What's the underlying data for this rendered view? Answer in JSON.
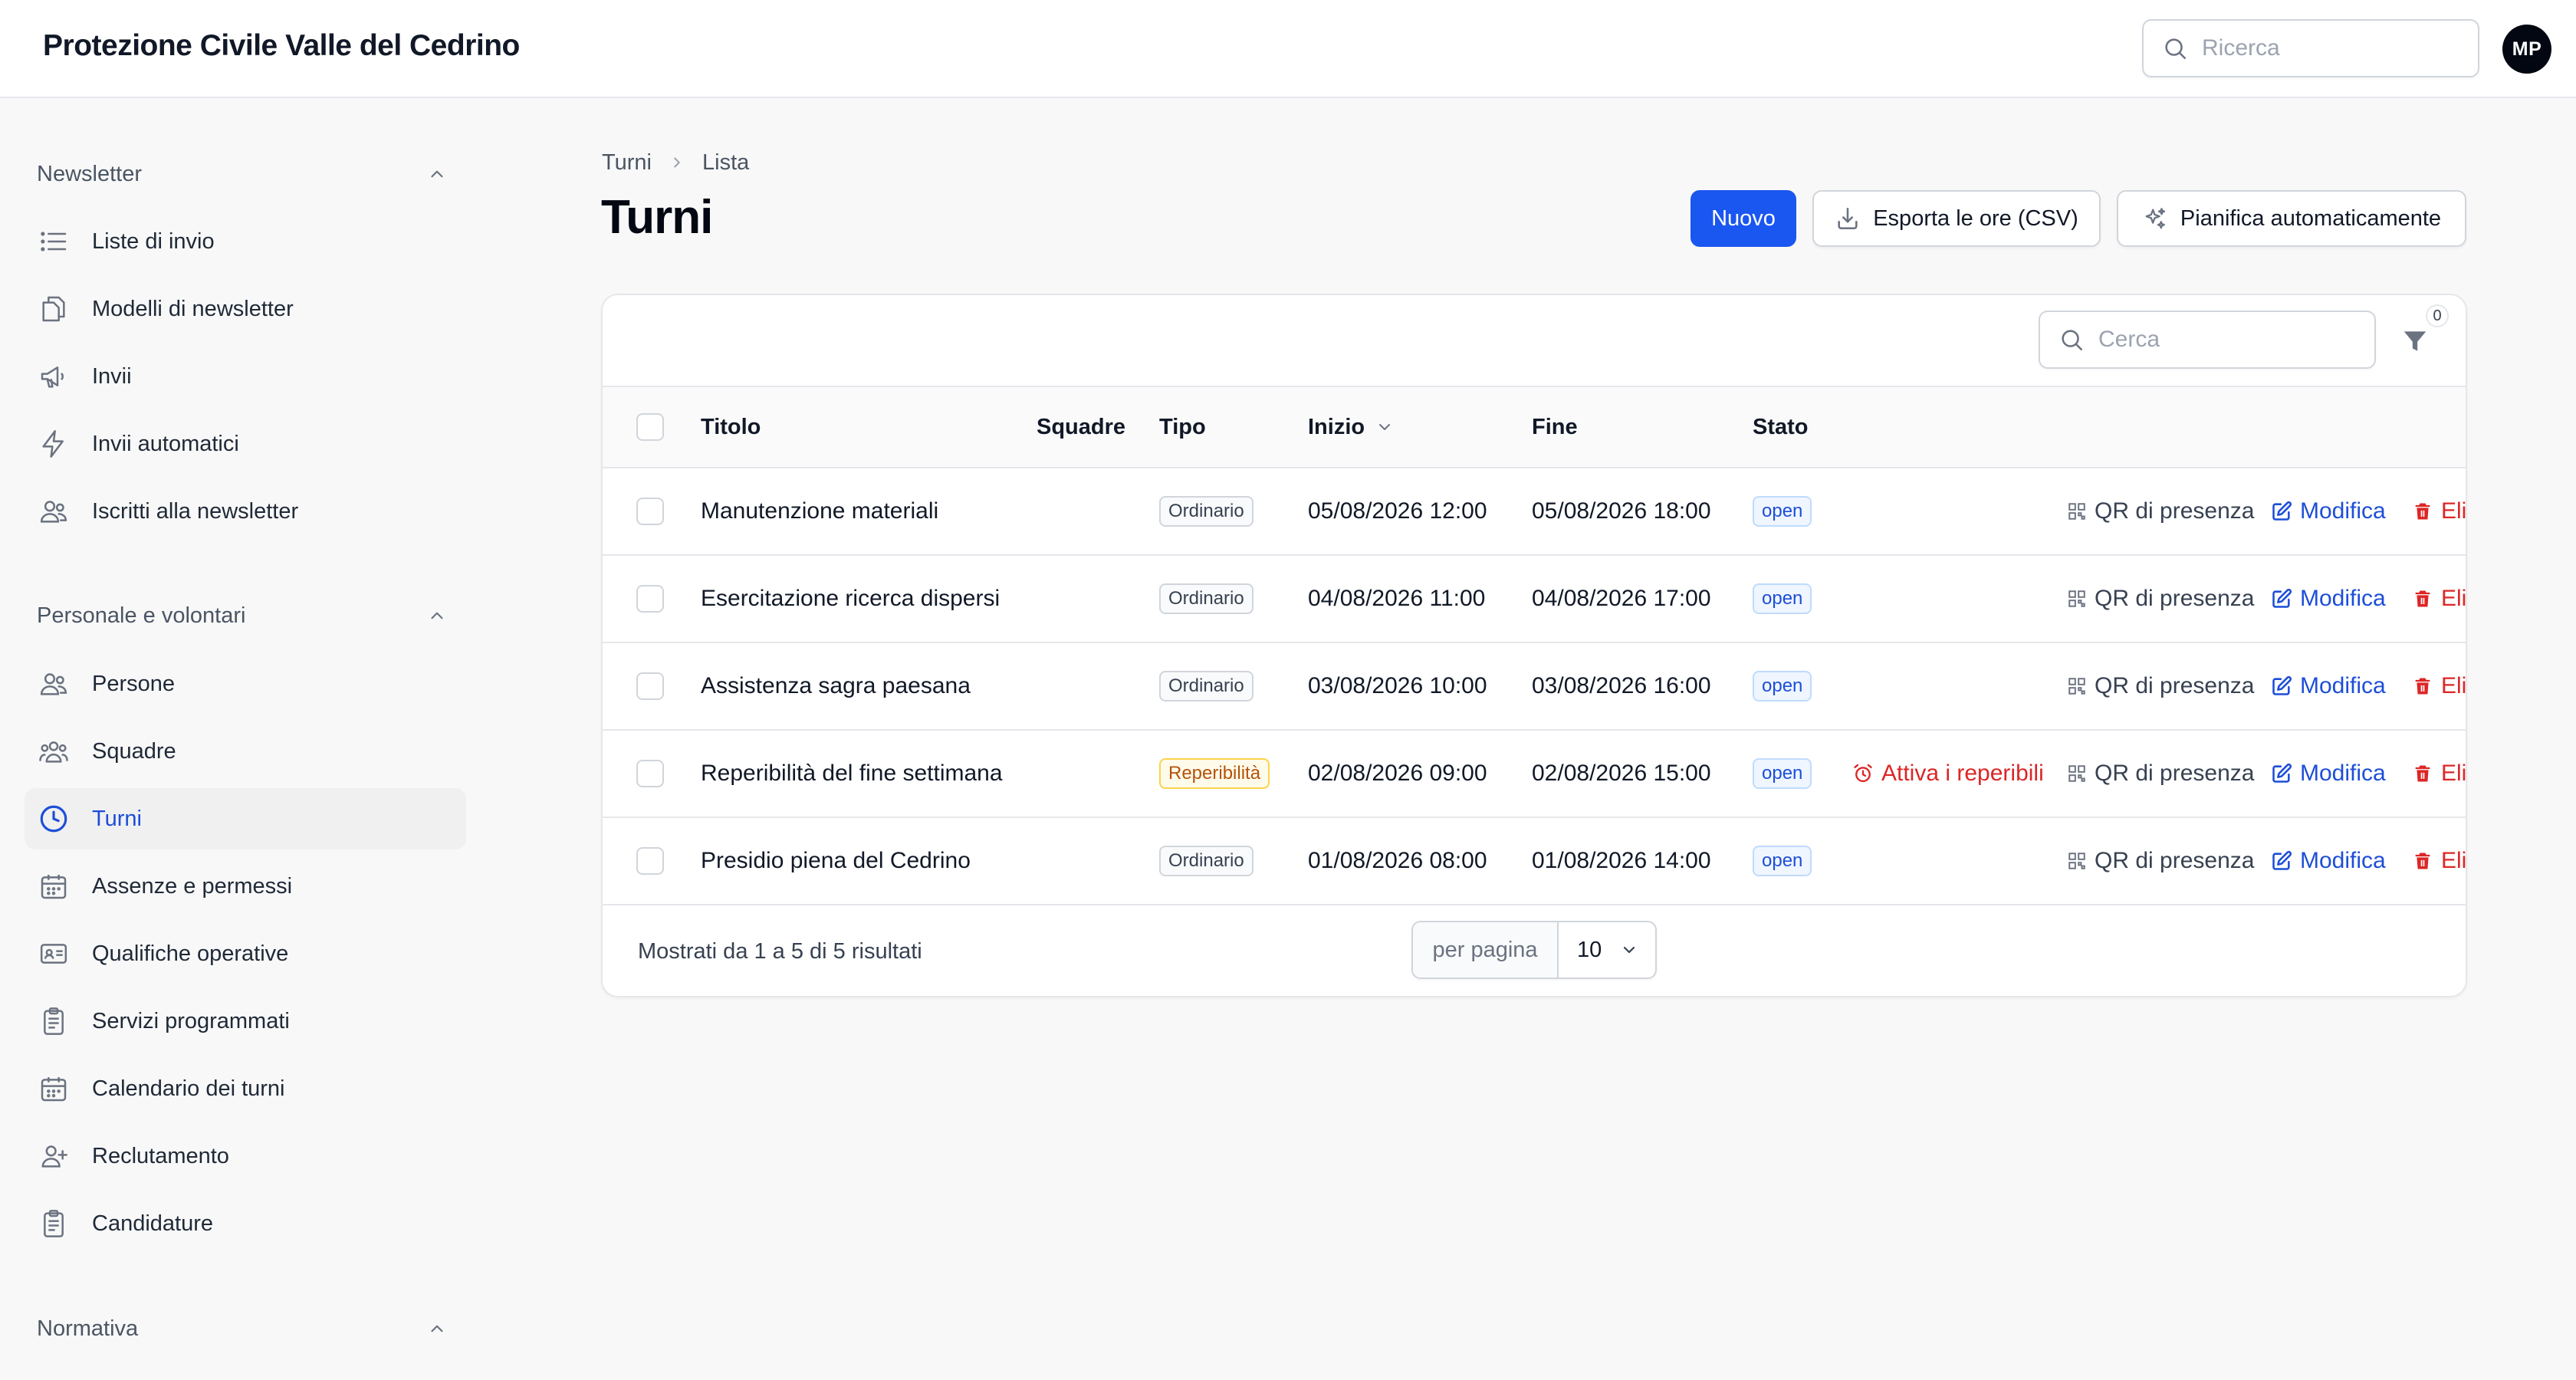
{
  "app": {
    "title": "Protezione Civile Valle del Cedrino",
    "search_placeholder": "Ricerca",
    "avatar_initials": "MP"
  },
  "sidebar": {
    "groups": [
      {
        "label": "Newsletter",
        "items": [
          {
            "label": "Liste di invio",
            "icon": "list-icon"
          },
          {
            "label": "Modelli di newsletter",
            "icon": "documents-icon"
          },
          {
            "label": "Invii",
            "icon": "megaphone-icon"
          },
          {
            "label": "Invii automatici",
            "icon": "bolt-icon"
          },
          {
            "label": "Iscritti alla newsletter",
            "icon": "users-icon"
          }
        ]
      },
      {
        "label": "Personale e volontari",
        "items": [
          {
            "label": "Persone",
            "icon": "users-icon"
          },
          {
            "label": "Squadre",
            "icon": "user-group-icon"
          },
          {
            "label": "Turni",
            "icon": "clock-icon",
            "active": true
          },
          {
            "label": "Assenze e permessi",
            "icon": "calendar-icon"
          },
          {
            "label": "Qualifiche operative",
            "icon": "id-card-icon"
          },
          {
            "label": "Servizi programmati",
            "icon": "clipboard-icon"
          },
          {
            "label": "Calendario dei turni",
            "icon": "calendar-icon"
          },
          {
            "label": "Reclutamento",
            "icon": "user-plus-icon"
          },
          {
            "label": "Candidature",
            "icon": "clipboard-icon"
          }
        ]
      },
      {
        "label": "Normativa",
        "items": []
      }
    ]
  },
  "page": {
    "breadcrumb": [
      "Turni",
      "Lista"
    ],
    "title": "Turni",
    "actions": {
      "new": "Nuovo",
      "export": "Esporta le ore (CSV)",
      "plan": "Pianifica automaticamente"
    }
  },
  "table": {
    "search_placeholder": "Cerca",
    "filter_count": "0",
    "columns": {
      "title": "Titolo",
      "teams": "Squadre",
      "type": "Tipo",
      "start": "Inizio",
      "end": "Fine",
      "status": "Stato"
    },
    "action_labels": {
      "qr": "QR di presenza",
      "edit": "Modifica",
      "delete": "Elimina",
      "activate": "Attiva i reperibili"
    },
    "rows": [
      {
        "title": "Manutenzione materiali",
        "type": "Ordinario",
        "start": "05/08/2026 12:00",
        "end": "05/08/2026 18:00",
        "status": "open"
      },
      {
        "title": "Esercitazione ricerca dispersi",
        "type": "Ordinario",
        "start": "04/08/2026 11:00",
        "end": "04/08/2026 17:00",
        "status": "open"
      },
      {
        "title": "Assistenza sagra paesana",
        "type": "Ordinario",
        "start": "03/08/2026 10:00",
        "end": "03/08/2026 16:00",
        "status": "open"
      },
      {
        "title": "Reperibilità del fine settimana",
        "type": "Reperibilità",
        "start": "02/08/2026 09:00",
        "end": "02/08/2026 15:00",
        "status": "open",
        "on_call": true
      },
      {
        "title": "Presidio piena del Cedrino",
        "type": "Ordinario",
        "start": "01/08/2026 08:00",
        "end": "01/08/2026 14:00",
        "status": "open"
      }
    ],
    "footer": {
      "summary": "Mostrati da 1 a 5 di 5 risultati",
      "per_page_label": "per pagina",
      "per_page_value": "10"
    }
  },
  "colors": {
    "primary": "#1a56f0",
    "active_text": "#1d4ed8",
    "danger": "#dc2626"
  }
}
